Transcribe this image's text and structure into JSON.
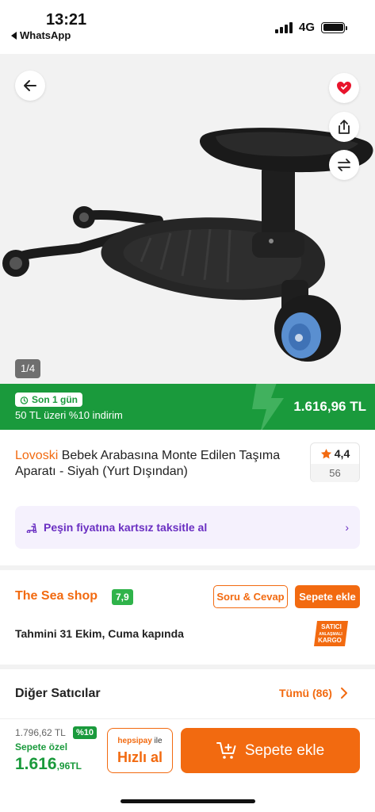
{
  "status_bar": {
    "time": "13:21",
    "back_app": "WhatsApp",
    "network": "4G"
  },
  "gallery": {
    "pager": "1/4",
    "icons": [
      "arrow-left-icon",
      "heart-icon",
      "share-icon",
      "compare-icon"
    ]
  },
  "deal": {
    "tag": "Son 1 gün",
    "subtitle": "50 TL üzeri %10 indirim",
    "price": "1.616,96 TL"
  },
  "product": {
    "brand": "Lovoski",
    "title": " Bebek Arabasına Monte Edilen Taşıma Aparatı - Siyah (Yurt Dışından)",
    "rating": "4,4",
    "review_count": "56"
  },
  "installment": {
    "text": "Peşin fiyatına kartsız taksitle al"
  },
  "seller": {
    "name": "The Sea shop",
    "score": "7,9",
    "qa_label": "Soru & Cevap",
    "add_label": "Sepete ekle",
    "delivery": "Tahmini 31 Ekim, Cuma kapında",
    "cargo_badge": {
      "line1": "SATICI",
      "line2": "ANLAŞMALI",
      "line3": "KARGO"
    }
  },
  "other_sellers": {
    "title": "Diğer Satıcılar",
    "all_label": "Tümü (86)"
  },
  "bottom_bar": {
    "old_price": "1.796,62 TL",
    "discount": "%10",
    "special_label": "Sepete özel",
    "final_price_main": "1.616",
    "final_price_rest": ",96TL",
    "hepsipay_brand": "hepsipay",
    "hepsipay_suffix": " ile",
    "quick_buy": "Hızlı al",
    "add_to_cart": "Sepete ekle"
  },
  "colors": {
    "accent": "#f26a10",
    "deal_green": "#1a9a3c",
    "installment_purple": "#6a2fc2",
    "rating_star": "#f26a10"
  }
}
